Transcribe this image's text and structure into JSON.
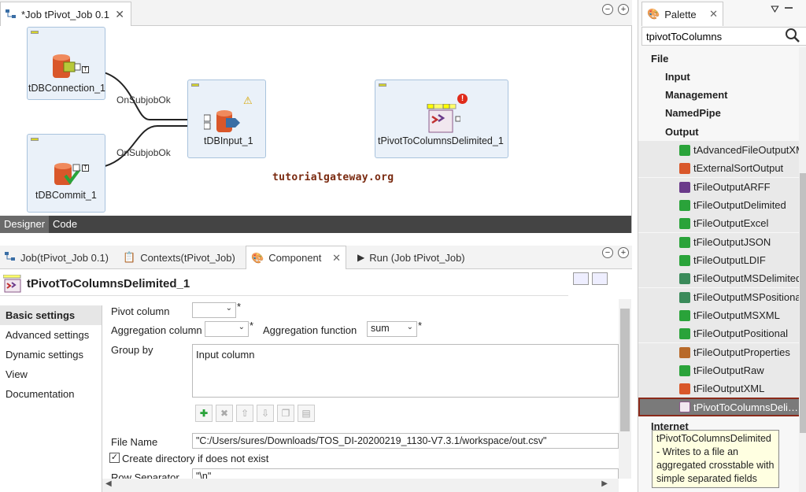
{
  "job_editor": {
    "tab_title": "*Job tPivot_Job 0.1",
    "components": {
      "db_connection": "tDBConnection_1",
      "db_input": "tDBInput_1",
      "db_commit": "tDBCommit_1",
      "pivot": "tPivotToColumnsDelimited_1"
    },
    "links": {
      "onsubjob_1": "OnSubjobOk",
      "onsubjob_2": "OnSubjobOk"
    },
    "watermark": "tutorialgateway.org",
    "designer_tabs": [
      "Designer",
      "Code"
    ]
  },
  "bottom_panel": {
    "tabs": [
      "Job(tPivot_Job 0.1)",
      "Contexts(tPivot_Job)",
      "Component",
      "Run (Job tPivot_Job)"
    ],
    "component_title": "tPivotToColumnsDelimited_1",
    "side_nav": [
      "Basic settings",
      "Advanced settings",
      "Dynamic settings",
      "View",
      "Documentation"
    ],
    "settings": {
      "pivot_column_label": "Pivot column",
      "pivot_column_value": "",
      "aggregation_column_label": "Aggregation column",
      "aggregation_column_value": "",
      "aggregation_function_label": "Aggregation function",
      "aggregation_function_value": "sum",
      "group_by_label": "Group by",
      "group_by_header": "Input column",
      "file_name_label": "File Name",
      "file_name_value": "\"C:/Users/sures/Downloads/TOS_DI-20200219_1130-V7.3.1/workspace/out.csv\"",
      "create_dir_label": "Create directory if does not exist",
      "create_dir_checked": true,
      "row_separator_label": "Row Separator",
      "row_separator_value": "\"\\n\""
    }
  },
  "palette": {
    "tab_title": "Palette",
    "search_value": "tpivotToColumns",
    "groups": {
      "file": "File",
      "input": "Input",
      "management": "Management",
      "namedpipe": "NamedPipe",
      "output": "Output",
      "internet": "Internet"
    },
    "output_items": [
      "tAdvancedFileOutputXML",
      "tExternalSortOutput",
      "tFileOutputARFF",
      "tFileOutputDelimited",
      "tFileOutputExcel",
      "tFileOutputJSON",
      "tFileOutputLDIF",
      "tFileOutputMSDelimited",
      "tFileOutputMSPositional",
      "tFileOutputMSXML",
      "tFileOutputPositional",
      "tFileOutputProperties",
      "tFileOutputRaw",
      "tFileOutputXML"
    ],
    "selected_item": "tPivotToColumnsDelimited",
    "tooltip": "tPivotToColumnsDelimited - Writes to a file an aggregated crosstable with simple separated fields"
  }
}
